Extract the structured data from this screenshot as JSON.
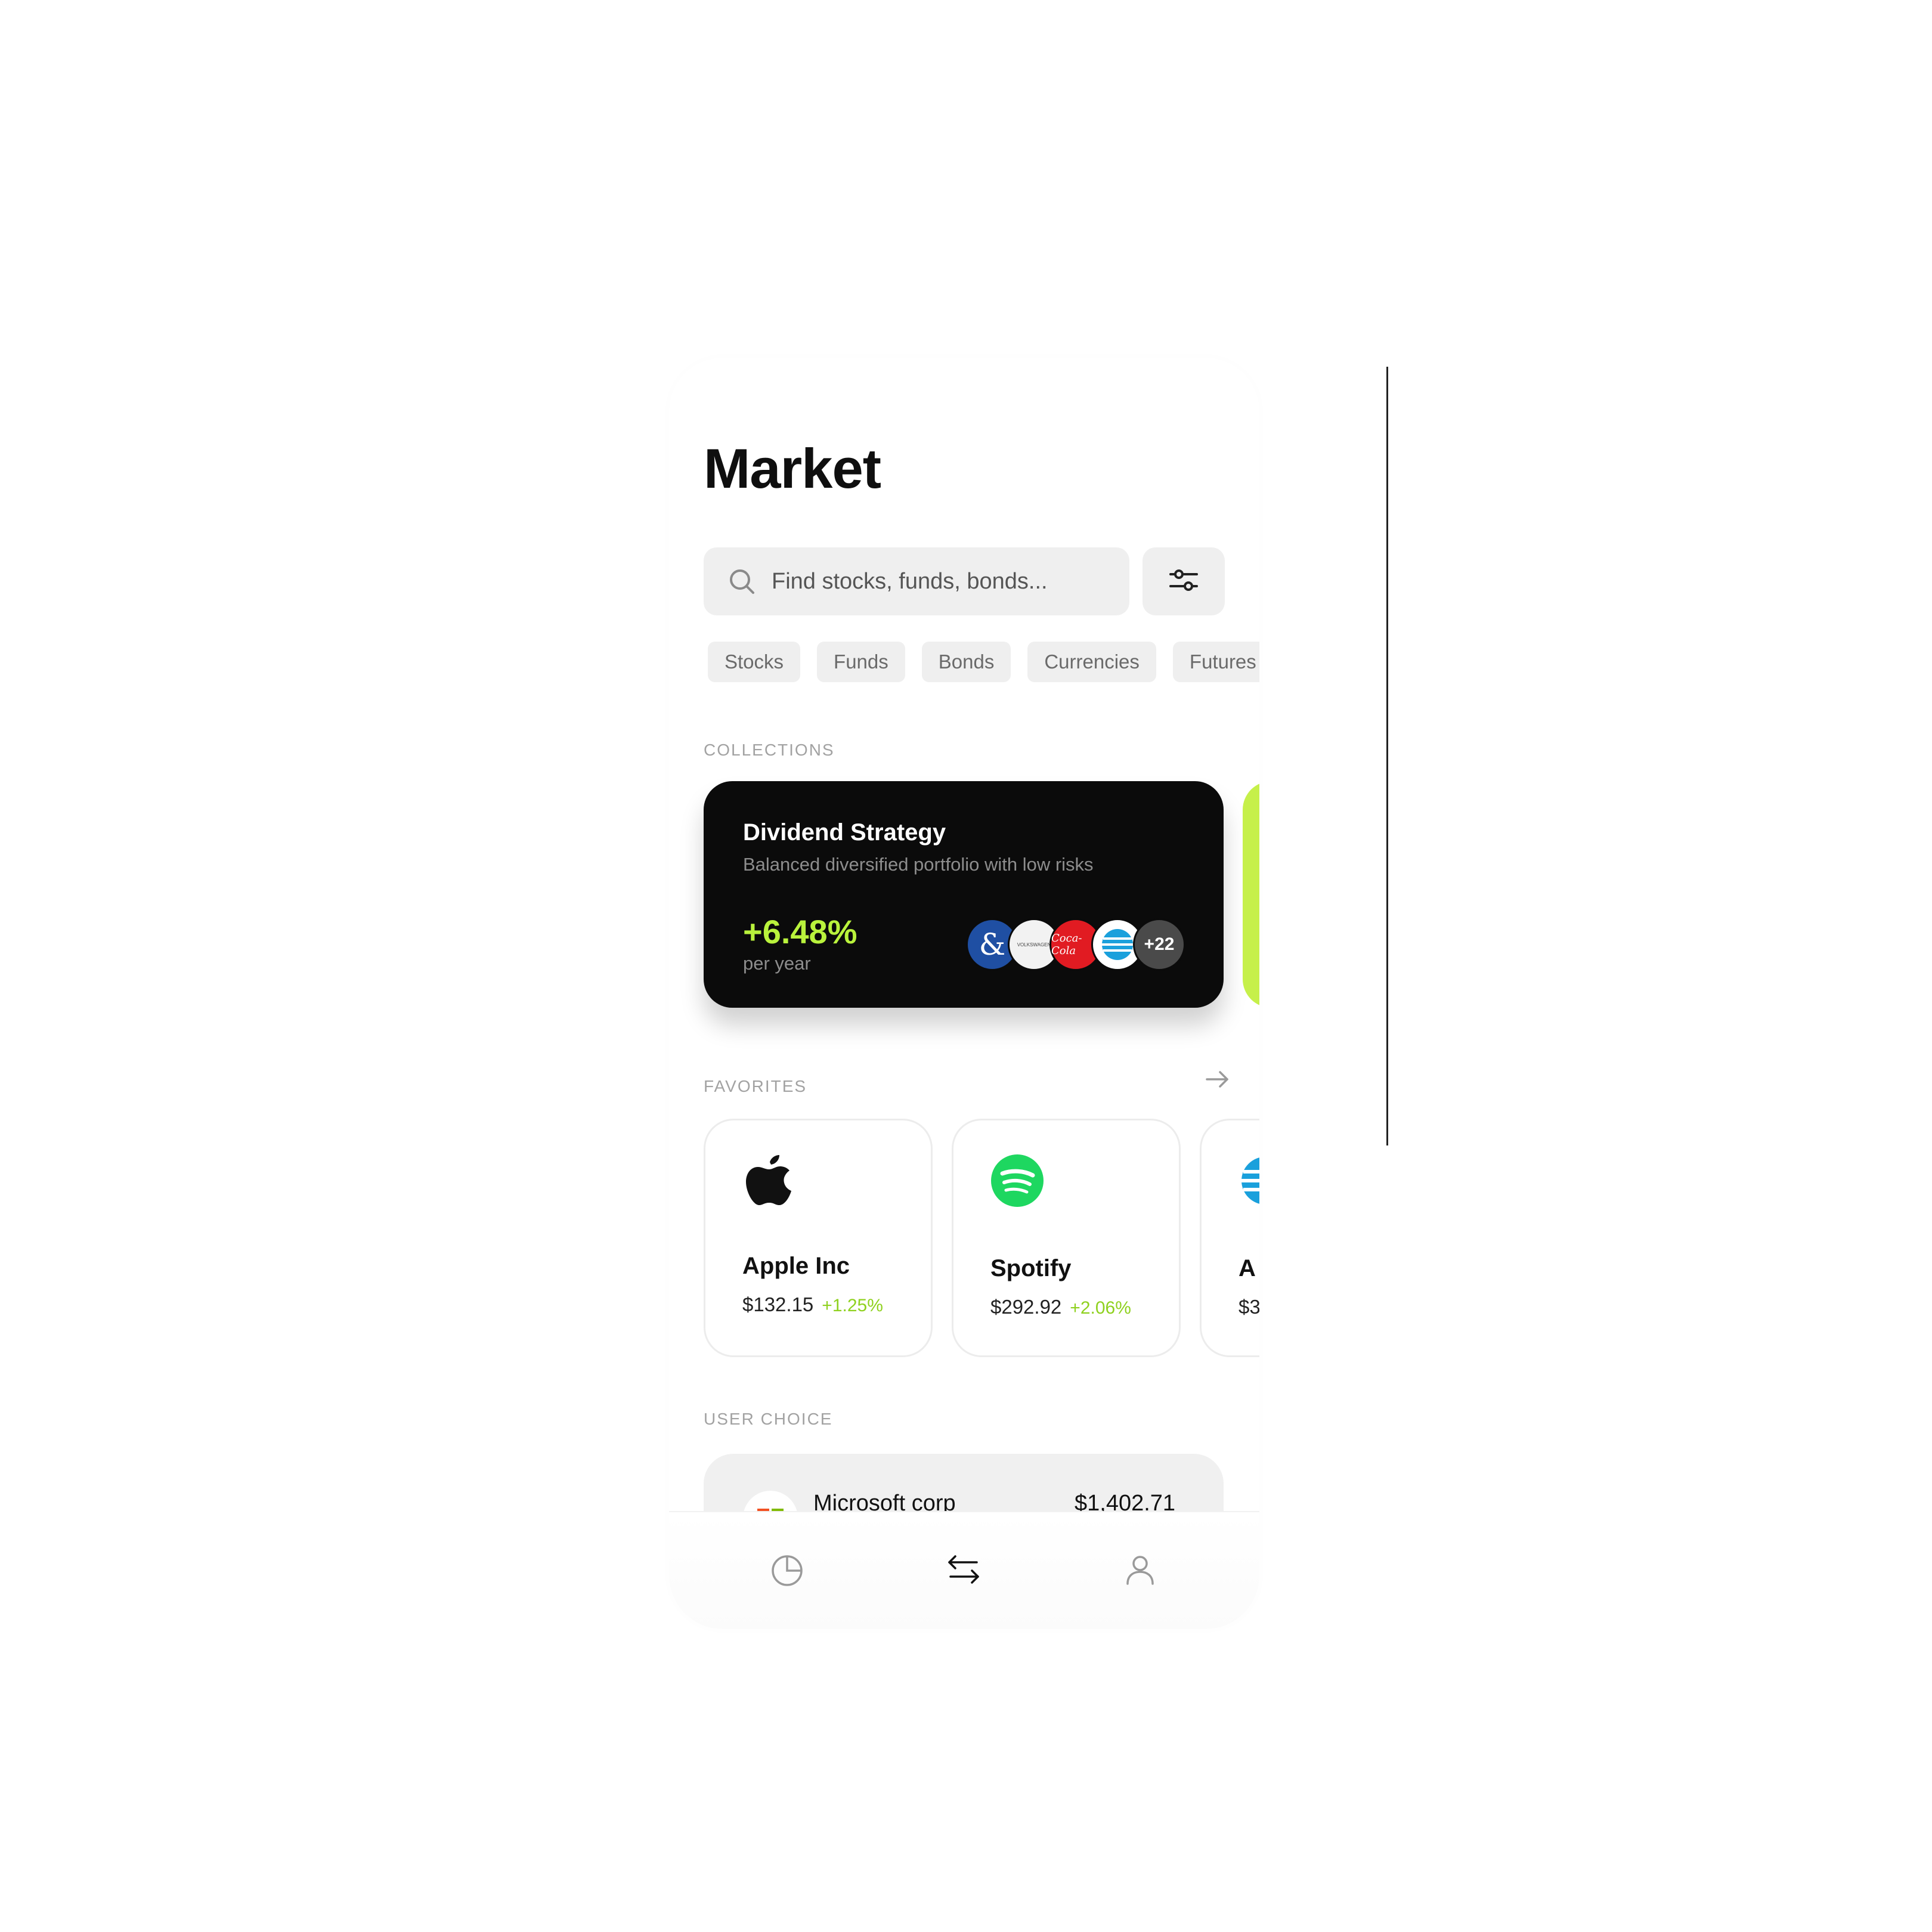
{
  "screen": {
    "title": "Market"
  },
  "search": {
    "placeholder": "Find stocks, funds, bonds..."
  },
  "filter_button": {
    "icon": "sliders-icon"
  },
  "categories": [
    "Stocks",
    "Funds",
    "Bonds",
    "Currencies",
    "Futures"
  ],
  "collections": {
    "label": "COLLECTIONS",
    "card": {
      "title": "Dividend Strategy",
      "subtitle": "Balanced diversified portfolio with low risks",
      "rate": "+6.48%",
      "period": "per year",
      "more_count": "+22",
      "logos": [
        {
          "name": "ampersand",
          "text": "&",
          "color": "#1f4fa3"
        },
        {
          "name": "volkswagen",
          "text": "VOLKSWAGEN",
          "color": "#f2f2f2"
        },
        {
          "name": "coca-cola",
          "text": "Coca-Cola",
          "color": "#e11b22"
        },
        {
          "name": "att",
          "text": "",
          "color": "#ffffff"
        }
      ]
    },
    "next_card_color": "#c6f04a"
  },
  "favorites": {
    "label": "FAVORITES",
    "items": [
      {
        "name": "Apple Inc",
        "price": "$132.15",
        "change": "+1.25%",
        "icon": "apple-icon"
      },
      {
        "name": "Spotify",
        "price": "$292.92",
        "change": "+2.06%",
        "icon": "spotify-icon"
      },
      {
        "name": "A",
        "price": "$3",
        "change": "",
        "icon": "att-icon"
      }
    ]
  },
  "user_choice": {
    "label": "USER CHOICE",
    "items": [
      {
        "name": "Microsoft corp",
        "price": "$1,402.71",
        "icon": "microsoft-icon"
      }
    ]
  },
  "tabbar": {
    "items": [
      {
        "icon": "pie-chart-icon",
        "active": false
      },
      {
        "icon": "transfer-arrows-icon",
        "active": true
      },
      {
        "icon": "user-icon",
        "active": false
      }
    ]
  },
  "colors": {
    "accent_green": "#b9f23c",
    "positive": "#8fd11f",
    "card_dark": "#0b0b0b",
    "chip_bg": "#efefef"
  }
}
